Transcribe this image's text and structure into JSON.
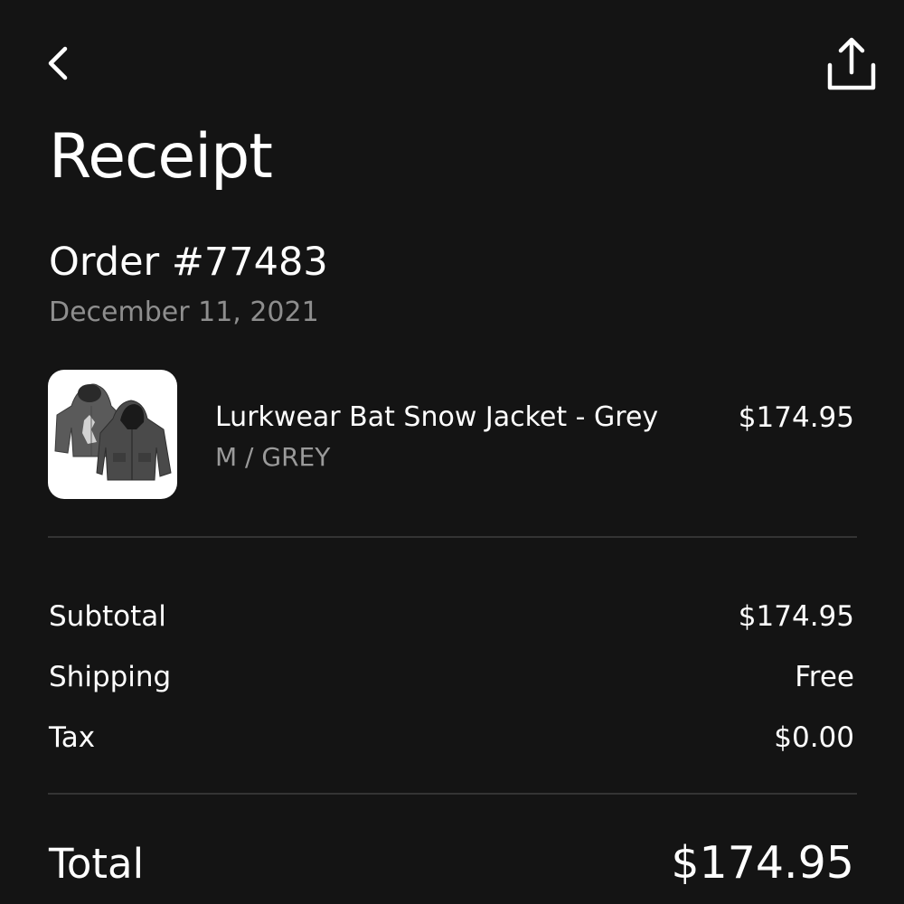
{
  "header": {
    "back_icon": "chevron-left-icon",
    "share_icon": "share-icon",
    "title": "Receipt"
  },
  "order": {
    "number": "Order #77483",
    "date": "December 11, 2021"
  },
  "item": {
    "name": "Lurkwear Bat Snow Jacket - Grey",
    "variant": "M / GREY",
    "price": "$174.95",
    "image_icon": "jacket-product-image"
  },
  "summary": {
    "subtotal_label": "Subtotal",
    "subtotal_value": "$174.95",
    "shipping_label": "Shipping",
    "shipping_value": "Free",
    "tax_label": "Tax",
    "tax_value": "$0.00"
  },
  "total": {
    "label": "Total",
    "value": "$174.95"
  },
  "colors": {
    "background": "#141414",
    "text": "#ffffff",
    "muted_text": "#8e8e8e",
    "divider": "#343434"
  }
}
